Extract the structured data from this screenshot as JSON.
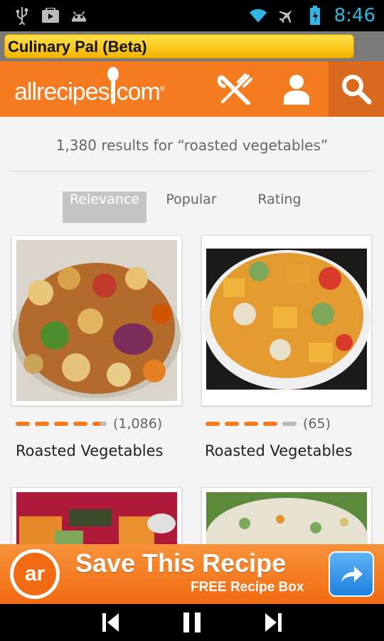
{
  "status_bar": {
    "time": "8:46",
    "icons_left": [
      "usb-icon",
      "play-store-icon",
      "android-icon"
    ],
    "icons_right": [
      "wifi-icon",
      "airplane-icon",
      "battery-icon"
    ]
  },
  "app_title": "Culinary Pal (Beta)",
  "header": {
    "logo_text_left": "allrecipes",
    "logo_text_right": "com",
    "logo_mark": "®",
    "icons": [
      "utensils-icon",
      "user-icon",
      "search-icon"
    ]
  },
  "results_text": "1,380 results for “roasted vegetables”",
  "sort_tabs": [
    {
      "label": "Relevance",
      "active": true
    },
    {
      "label": "Popular",
      "active": false
    },
    {
      "label": "Rating",
      "active": false
    }
  ],
  "recipes": [
    {
      "name": "Roasted Vegetables",
      "rating": 4.5,
      "count": "(1,086)"
    },
    {
      "name": "Roasted Vegetables",
      "rating": 4.0,
      "count": "(65)"
    }
  ],
  "ad": {
    "logo_text": "ar",
    "title": "Save This Recipe",
    "subtitle": "FREE Recipe Box"
  },
  "nav": [
    "previous-icon",
    "pause-icon",
    "next-icon"
  ],
  "colors": {
    "accent": "#f47b20",
    "title_yellow": "#f4b400",
    "status_blue": "#33b5e5"
  }
}
